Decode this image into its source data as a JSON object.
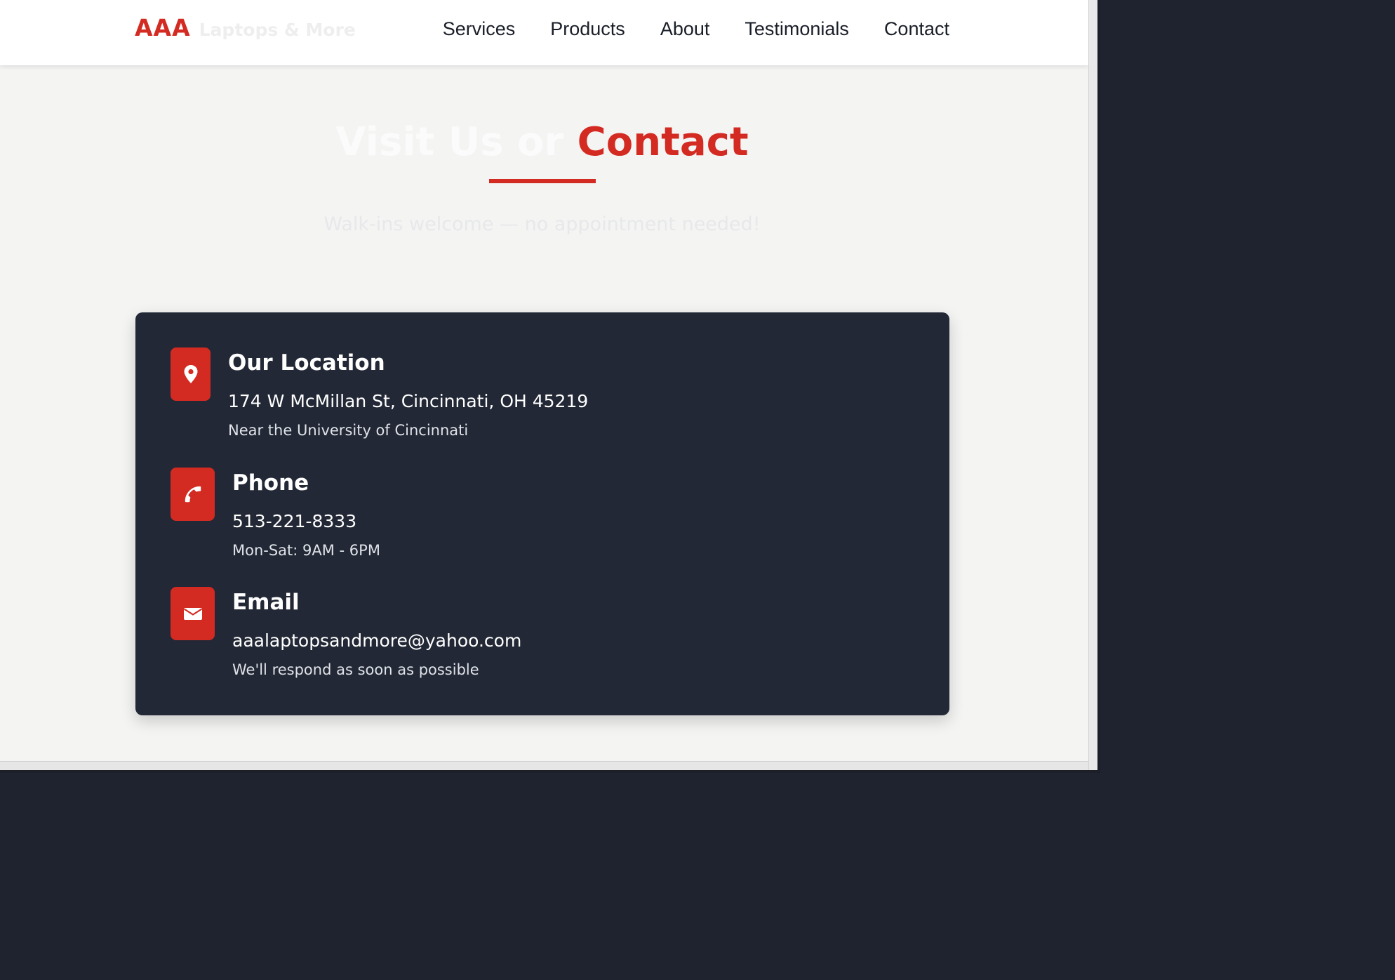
{
  "header": {
    "logo_brand": "AAA",
    "logo_tagline": "Laptops & More",
    "nav": [
      {
        "label": "Services"
      },
      {
        "label": "Products"
      },
      {
        "label": "About"
      },
      {
        "label": "Testimonials"
      },
      {
        "label": "Contact"
      }
    ]
  },
  "section": {
    "title_plain": "Visit Us or",
    "title_accent": "Contact",
    "subtitle": "Walk-ins welcome — no appointment needed!"
  },
  "contact_card": {
    "location": {
      "icon": "map-pin-icon",
      "heading": "Our Location",
      "primary": "174 W McMillan St, Cincinnati, OH 45219",
      "secondary": "Near the University of Cincinnati"
    },
    "phone": {
      "icon": "phone-icon",
      "heading": "Phone",
      "primary": "513-221-8333",
      "secondary": "Mon-Sat: 9AM - 6PM"
    },
    "email": {
      "icon": "envelope-icon",
      "heading": "Email",
      "primary": "aaalaptopsandmore@yahoo.com",
      "secondary": "We'll respond as soon as possible"
    }
  },
  "colors": {
    "accent": "#d32a22",
    "card_background": "#222835",
    "page_background": "#f4f4f3",
    "nav_text": "#1a1e28"
  }
}
